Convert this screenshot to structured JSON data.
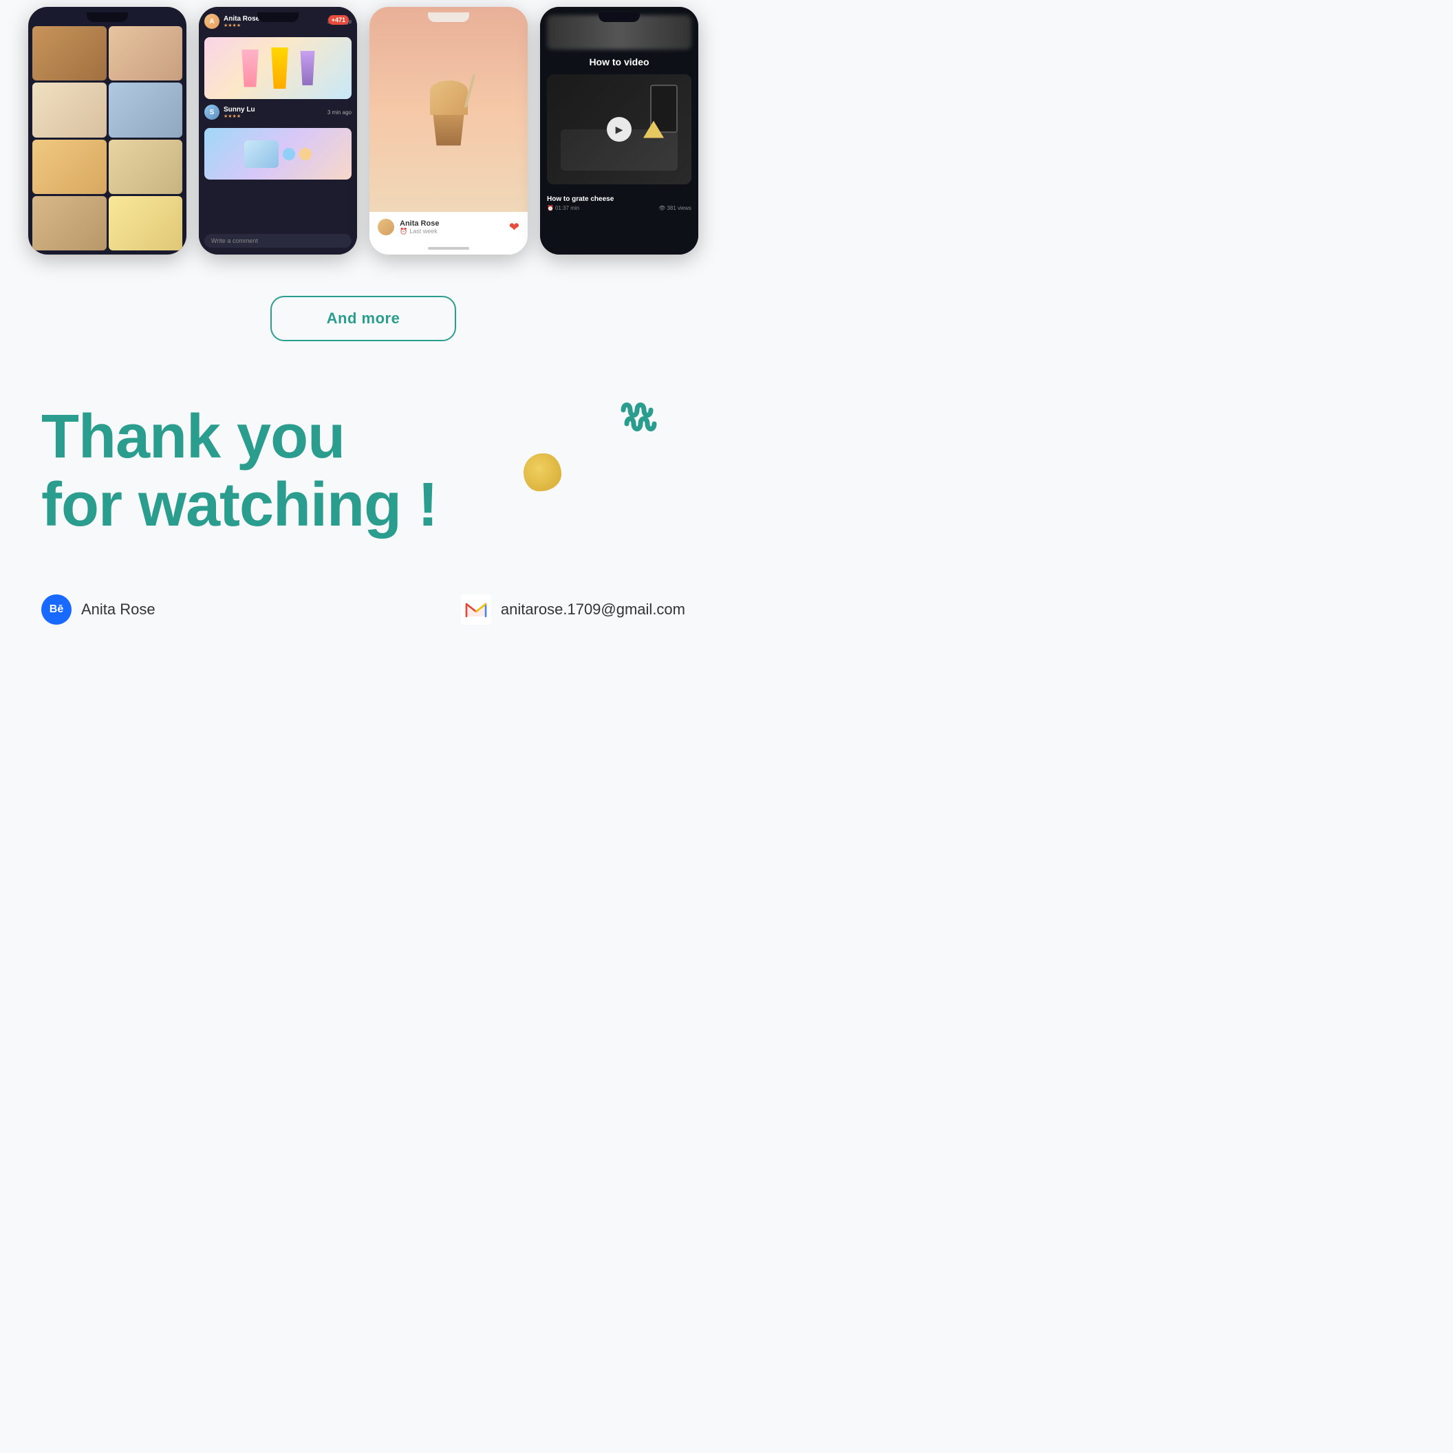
{
  "phones": [
    {
      "id": "phone-grid",
      "type": "grid",
      "label": "Food grid phone"
    },
    {
      "id": "phone-feed",
      "type": "social-feed",
      "label": "Social feed phone",
      "count_badge": "+471",
      "user1": {
        "name": "Anita Rose",
        "time": "3 min ago",
        "stars": "★★★★"
      },
      "user2": {
        "name": "Sunny Lu",
        "time": "3 min ago",
        "stars": "★★★★"
      },
      "comment_placeholder": "Write a comment"
    },
    {
      "id": "phone-product",
      "type": "product-detail",
      "label": "Product detail phone",
      "username": "Anita Rose",
      "date": "Last week"
    },
    {
      "id": "phone-video",
      "type": "how-to-video",
      "label": "How to video phone",
      "title": "How to video",
      "video_title": "How to grate cheese",
      "video_duration": "01:37 min",
      "video_views": "381 views"
    }
  ],
  "cta": {
    "label": "And more"
  },
  "thankyou": {
    "line1": "Thank you",
    "line2": "for watching !"
  },
  "footer": {
    "platform": "Bē",
    "name": "Anita Rose",
    "email_icon": "M",
    "email": "anitarose.1709@gmail.com"
  },
  "colors": {
    "teal": "#2a9d8f",
    "dark_bg": "#1c1c2e",
    "behance_blue": "#1769ff",
    "gold": "#d4a830",
    "text_dark": "#333333"
  },
  "decorations": {
    "squiggle": "〰",
    "blob_color": "#f0d060"
  }
}
